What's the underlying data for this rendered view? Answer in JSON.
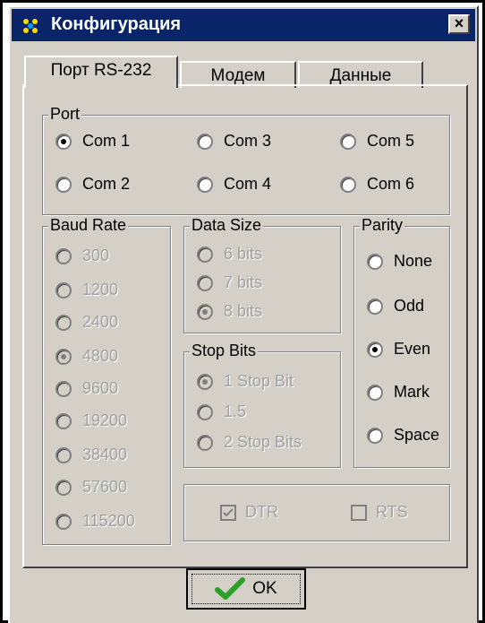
{
  "window": {
    "title": "Конфигурация",
    "close_label": "×"
  },
  "tabs": [
    {
      "label": "Порт RS-232",
      "active": true
    },
    {
      "label": "Модем",
      "active": false
    },
    {
      "label": "Данные",
      "active": false
    }
  ],
  "port": {
    "legend": "Port",
    "options": [
      "Com 1",
      "Com 2",
      "Com 3",
      "Com 4",
      "Com 5",
      "Com 6"
    ],
    "selected": "Com 1"
  },
  "baud_rate": {
    "legend": "Baud Rate",
    "options": [
      "300",
      "1200",
      "2400",
      "4800",
      "9600",
      "19200",
      "38400",
      "57600",
      "115200"
    ],
    "selected": "4800",
    "enabled": false
  },
  "data_size": {
    "legend": "Data Size",
    "options": [
      "6 bits",
      "7 bits",
      "8 bits"
    ],
    "selected": "8 bits",
    "enabled": false
  },
  "stop_bits": {
    "legend": "Stop Bits",
    "options": [
      "1 Stop Bit",
      "1.5",
      "2 Stop Bits"
    ],
    "selected": "1 Stop Bit",
    "enabled": false
  },
  "parity": {
    "legend": "Parity",
    "options": [
      "None",
      "Odd",
      "Even",
      "Mark",
      "Space"
    ],
    "selected": "Even"
  },
  "flow": {
    "dtr_label": "DTR",
    "dtr_checked": true,
    "rts_label": "RTS",
    "rts_checked": false,
    "enabled": false
  },
  "ok_label": "OK",
  "colors": {
    "titlebar": "#0a246a",
    "face": "#d4d0c8",
    "check_green": "#2aa02a"
  }
}
